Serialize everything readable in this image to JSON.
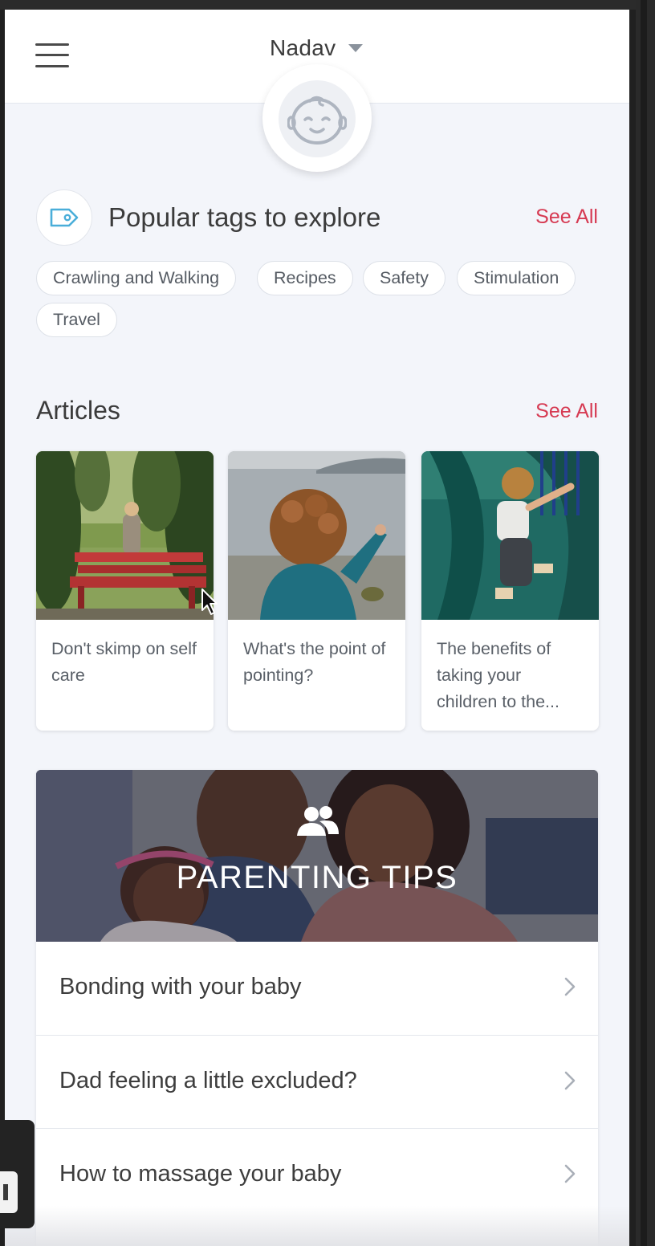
{
  "header": {
    "user_name": "Nadav"
  },
  "tags": {
    "title": "Popular tags to explore",
    "see_all": "See All",
    "items": [
      "Crawling and Walking",
      "Recipes",
      "Safety",
      "Stimulation",
      "Travel"
    ]
  },
  "articles": {
    "title": "Articles",
    "see_all": "See All",
    "items": [
      {
        "title": "Don't skimp on self care"
      },
      {
        "title": "What's the point of pointing?"
      },
      {
        "title": "The benefits of taking your children to the..."
      }
    ]
  },
  "tips": {
    "banner_title": "PARENTING TIPS",
    "items": [
      {
        "label": "Bonding with your baby"
      },
      {
        "label": "Dad feeling a little excluded?"
      },
      {
        "label": "How to massage your baby"
      }
    ]
  },
  "colors": {
    "accent": "#d63a52",
    "background": "#f3f5fa",
    "tag_icon": "#4aaed9"
  },
  "icons": {
    "menu": "hamburger-menu-icon",
    "user_caret": "caret-down-icon",
    "avatar": "baby-face-icon",
    "tags": "tag-icon",
    "tips_banner": "people-icon",
    "tip_row": "chevron-right-icon"
  }
}
